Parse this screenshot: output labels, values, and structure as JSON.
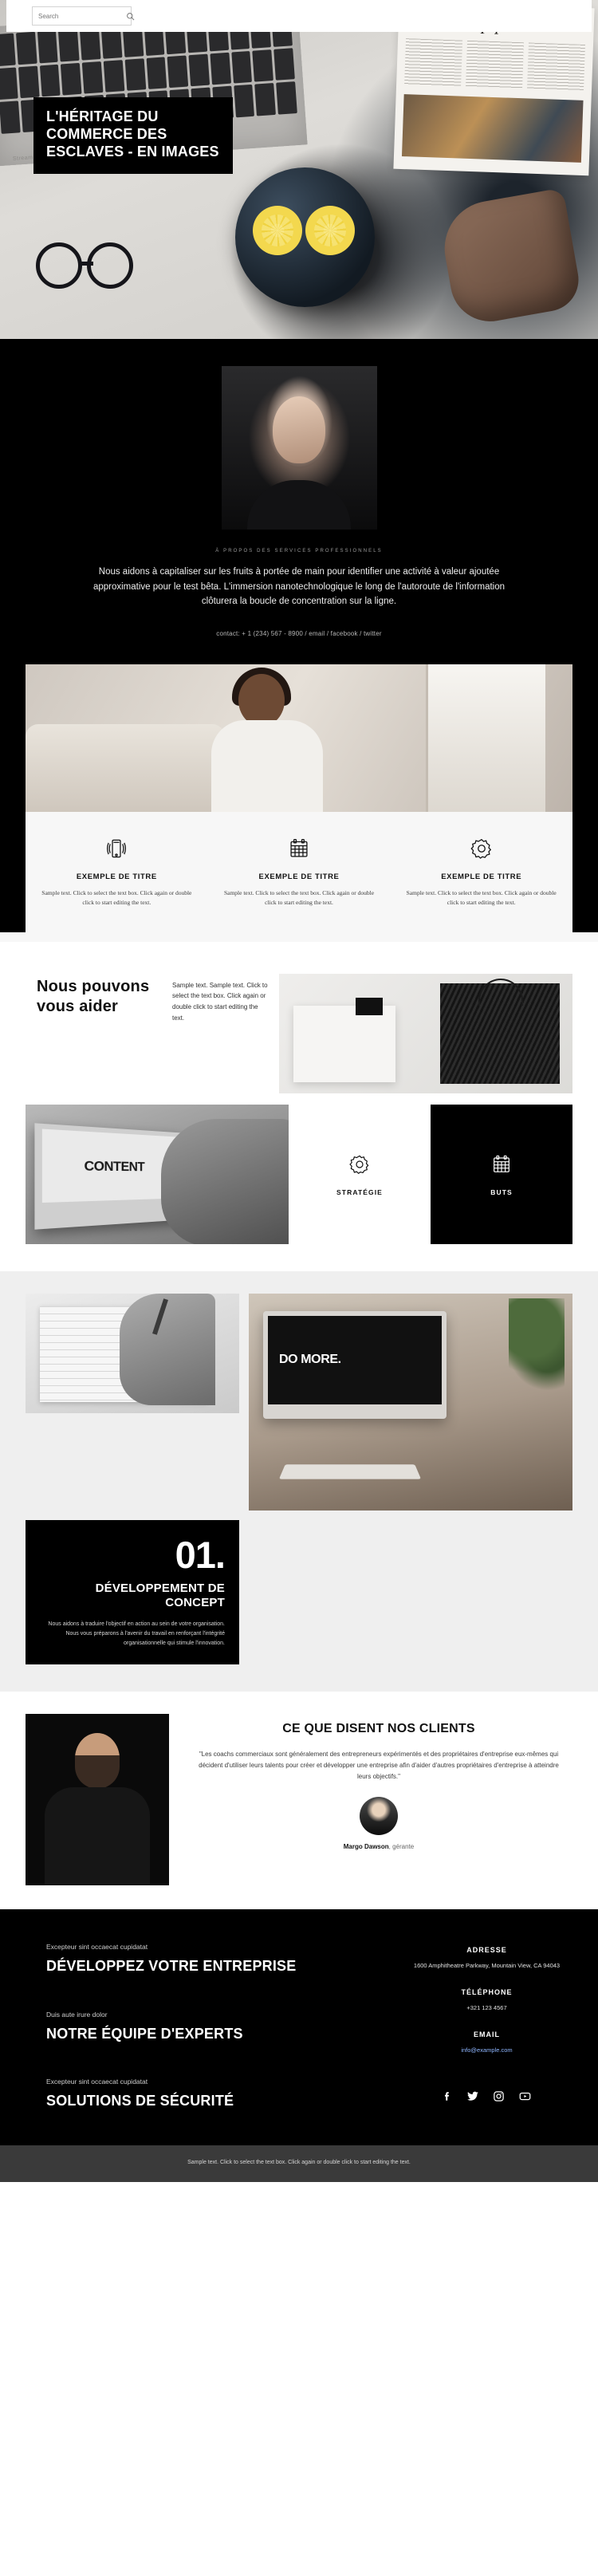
{
  "search": {
    "placeholder": "Search",
    "value": ""
  },
  "hero": {
    "title": "L'héritage du commerce des esclaves - en images"
  },
  "about": {
    "eyebrow": "À propos des services professionnels",
    "paragraph": "Nous aidons à capitaliser sur les fruits à portée de main pour identifier une activité à valeur ajoutée approximative pour le test bêta. L'immersion nanotechnologique le long de l'autoroute de l'information clôturera la boucle de concentration sur la ligne.",
    "contact": "contact: + 1 (234) 567 - 8900 / email / facebook / twitter"
  },
  "features": [
    {
      "icon": "mobile-signal-icon",
      "title": "Exemple de titre",
      "text": "Sample text. Click to select the text box. Click again or double click to start editing the text."
    },
    {
      "icon": "calendar-icon",
      "title": "Exemple de titre",
      "text": "Sample text. Click to select the text box. Click again or double click to start editing the text."
    },
    {
      "icon": "gear-icon",
      "title": "Exemple de titre",
      "text": "Sample text. Click to select the text box. Click again or double click to start editing the text."
    }
  ],
  "help": {
    "title": "Nous pouvons vous aider",
    "text": "Sample text. Sample text. Click to select the text box. Click again or double click to start editing the text.",
    "screen_word": "CONTENT",
    "cards": [
      {
        "icon": "gear-icon",
        "label": "Stratégie",
        "theme": "light"
      },
      {
        "icon": "calendar-icon",
        "label": "Buts",
        "theme": "dark"
      }
    ]
  },
  "concept": {
    "screen_text": "DO MORE.",
    "number": "01.",
    "heading": "Développement de concept",
    "text": "Nous aidons à traduire l'objectif en action au sein de votre organisation. Nous vous préparons à l'avenir du travail en renforçant l'intégrité organisationnelle qui stimule l'innovation."
  },
  "testimonials": {
    "heading": "Ce que disent nos clients",
    "quote": "\"Les coachs commerciaux sont généralement des entrepreneurs expérimentés et des propriétaires d'entreprise eux-mêmes qui décident d'utiliser leurs talents pour créer et développer une entreprise afin d'aider d'autres propriétaires d'entreprise à atteindre leurs objectifs.\"",
    "author_name": "Margo Dawson",
    "author_role": ", gérante"
  },
  "footer": {
    "blocks": [
      {
        "eyebrow": "Excepteur sint occaecat cupidatat",
        "heading": "Développez votre entreprise"
      },
      {
        "eyebrow": "Duis aute irure dolor",
        "heading": "Notre équipe d'experts"
      },
      {
        "eyebrow": "Excepteur sint occaecat cupidatat",
        "heading": "Solutions de sécurité"
      }
    ],
    "contact": [
      {
        "label": "Adresse",
        "value": "1600 Amphitheatre Parkway, Mountain View, CA 94043",
        "is_link": false
      },
      {
        "label": "Téléphone",
        "value": "+321 123 4567",
        "is_link": false
      },
      {
        "label": "Email",
        "value": "info@example.com",
        "is_link": true
      }
    ],
    "social": [
      "facebook-icon",
      "twitter-icon",
      "instagram-icon",
      "youtube-icon"
    ],
    "note": "Sample text. Click to select the text box. Click again or double click to start editing the text."
  },
  "colors": {
    "dark": "#000000",
    "light_panel": "#f7f7f7",
    "concept_bg": "#efefef",
    "note_bg": "#3a3a3a",
    "link": "#8fb6ff"
  }
}
